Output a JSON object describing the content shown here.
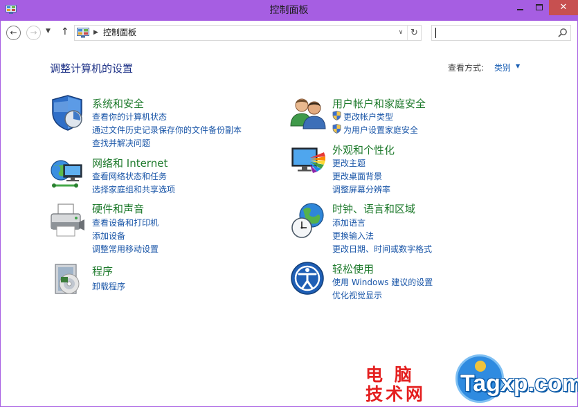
{
  "window": {
    "title": "控制面板",
    "close_glyph": "✕",
    "accent_color": "#a65ee2"
  },
  "nav": {
    "back_glyph": "←",
    "forward_glyph": "→",
    "recent_glyph": "▼",
    "up_glyph": "↑",
    "address_sep": "▶",
    "address_text": "控制面板",
    "dropdown_glyph": "∨",
    "refresh_glyph": "↻",
    "search_placeholder": ""
  },
  "content": {
    "page_title": "调整计算机的设置",
    "view_by_label": "查看方式:",
    "view_by_value": "类别",
    "view_by_arrow": "▼",
    "link_color": "#1a56a8",
    "heading_color": "#1e7a2c"
  },
  "categories": {
    "system": {
      "title": "系统和安全",
      "icon": "system-security-icon",
      "links": [
        "查看你的计算机状态",
        "通过文件历史记录保存你的文件备份副本",
        "查找并解决问题"
      ]
    },
    "network": {
      "title": "网络和 Internet",
      "icon": "network-icon",
      "links": [
        "查看网络状态和任务",
        "选择家庭组和共享选项"
      ]
    },
    "hardware": {
      "title": "硬件和声音",
      "icon": "printer-icon",
      "links": [
        "查看设备和打印机",
        "添加设备",
        "调整常用移动设置"
      ]
    },
    "programs": {
      "title": "程序",
      "icon": "programs-icon",
      "links": [
        "卸载程序"
      ]
    },
    "users": {
      "title": "用户帐户和家庭安全",
      "icon": "users-icon",
      "links": [
        "更改帐户类型",
        "为用户设置家庭安全"
      ]
    },
    "appearance": {
      "title": "外观和个性化",
      "icon": "appearance-icon",
      "links": [
        "更改主题",
        "更改桌面背景",
        "调整屏幕分辨率"
      ]
    },
    "clock": {
      "title": "时钟、语言和区域",
      "icon": "clock-globe-icon",
      "links": [
        "添加语言",
        "更换输入法",
        "更改日期、时间或数字格式"
      ]
    },
    "ease": {
      "title": "轻松使用",
      "icon": "ease-of-access-icon",
      "links": [
        "使用 Windows 建议的设置",
        "优化视觉显示"
      ]
    }
  },
  "watermark": {
    "cn": "电 脑\n技术网",
    "en": "Tagxp.com"
  }
}
